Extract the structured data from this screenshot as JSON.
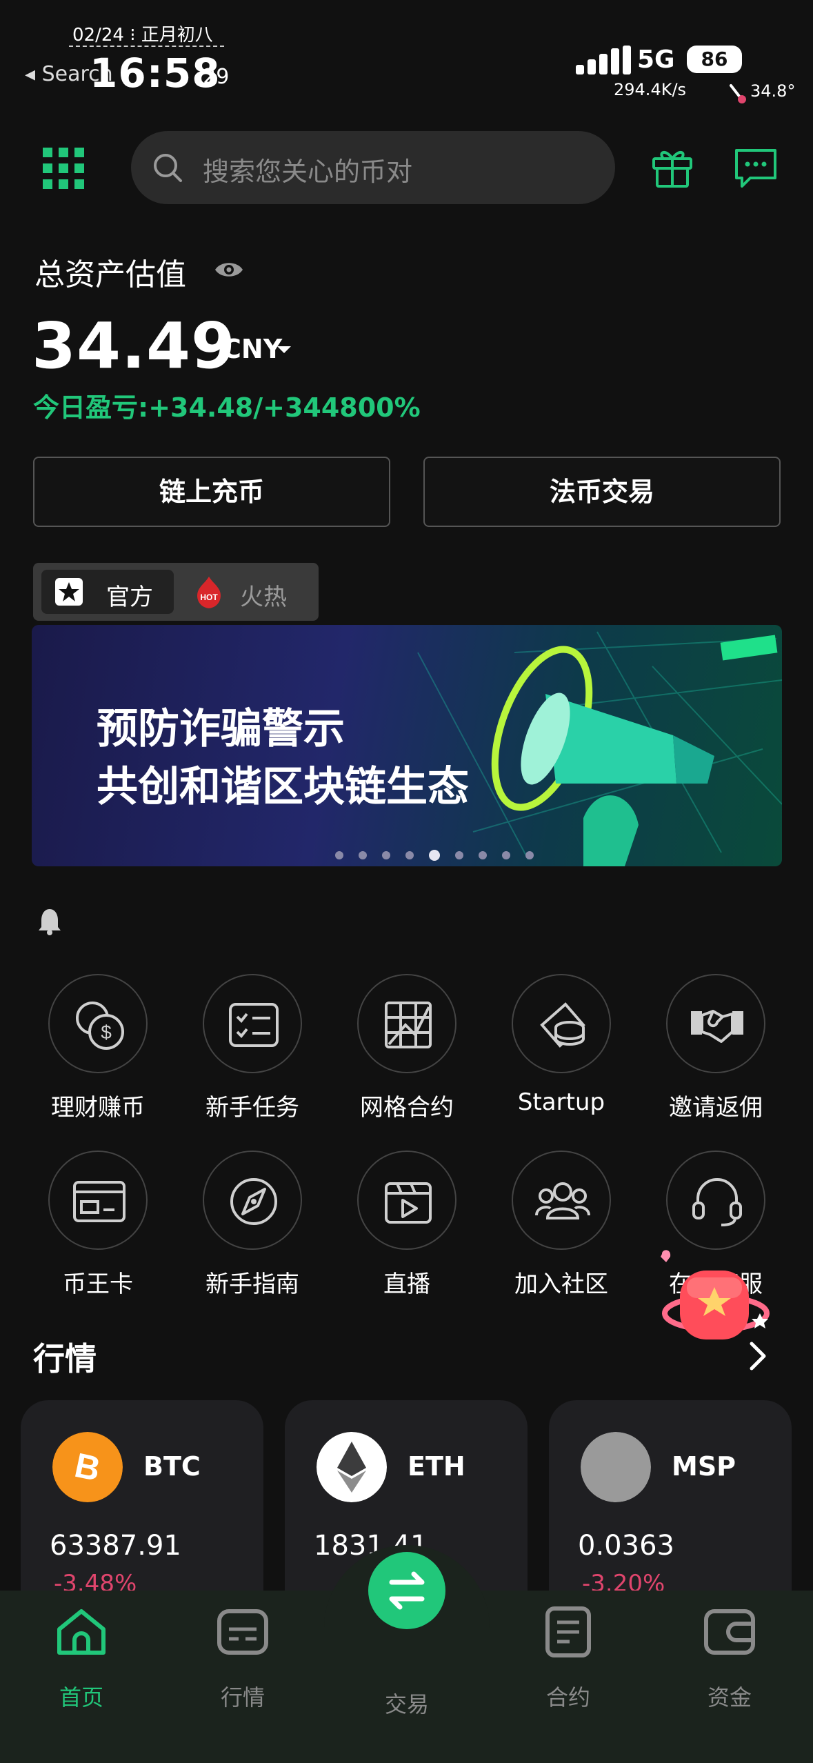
{
  "status_bar": {
    "date": "02/24 ⁝ 正月初八",
    "back_label": "Search",
    "time": "16:58",
    "seconds": ":29",
    "network": "5G",
    "battery": "86",
    "speed": "294.4K/s",
    "temperature": "34.8°"
  },
  "header": {
    "search_placeholder": "搜索您关心的币对"
  },
  "assets": {
    "label": "总资产估值",
    "value": "34.49",
    "currency": "CNY",
    "pnl": "今日盈亏:+34.48/+344800%"
  },
  "actions": {
    "deposit": "链上充币",
    "fiat": "法币交易"
  },
  "tabs": {
    "official": "官方",
    "hot_badge": "HOT",
    "hot": "火热"
  },
  "banner": {
    "line1": "预防诈骗警示",
    "line2": "共创和谐区块链生态",
    "slide_count": 9,
    "active_slide": 5
  },
  "features": [
    {
      "label": "理财赚币",
      "icon": "coins-icon"
    },
    {
      "label": "新手任务",
      "icon": "task-list-icon"
    },
    {
      "label": "网格合约",
      "icon": "grid-icon"
    },
    {
      "label": "Startup",
      "icon": "coin-stack-icon"
    },
    {
      "label": "邀请返佣",
      "icon": "handshake-icon"
    },
    {
      "label": "币王卡",
      "icon": "card-icon"
    },
    {
      "label": "新手指南",
      "icon": "compass-icon"
    },
    {
      "label": "直播",
      "icon": "live-video-icon"
    },
    {
      "label": "加入社区",
      "icon": "community-icon"
    },
    {
      "label": "在线客服",
      "icon": "headset-icon"
    }
  ],
  "market": {
    "title": "行情",
    "cards": [
      {
        "symbol": "BTC",
        "price": "63387.91",
        "change": "-3.48%",
        "color": "#f7931a"
      },
      {
        "symbol": "ETH",
        "price": "1831.41",
        "change": "",
        "color": "#ffffff"
      },
      {
        "symbol": "MSP",
        "price": "0.0363",
        "change": "-3.20%",
        "color": "#9a9a9a"
      }
    ]
  },
  "bottom_nav": {
    "home": "首页",
    "market": "行情",
    "trade": "交易",
    "contract": "合约",
    "funds": "资金"
  },
  "colors": {
    "accent": "#21c77a",
    "negative": "#e0456d",
    "background": "#111111"
  }
}
